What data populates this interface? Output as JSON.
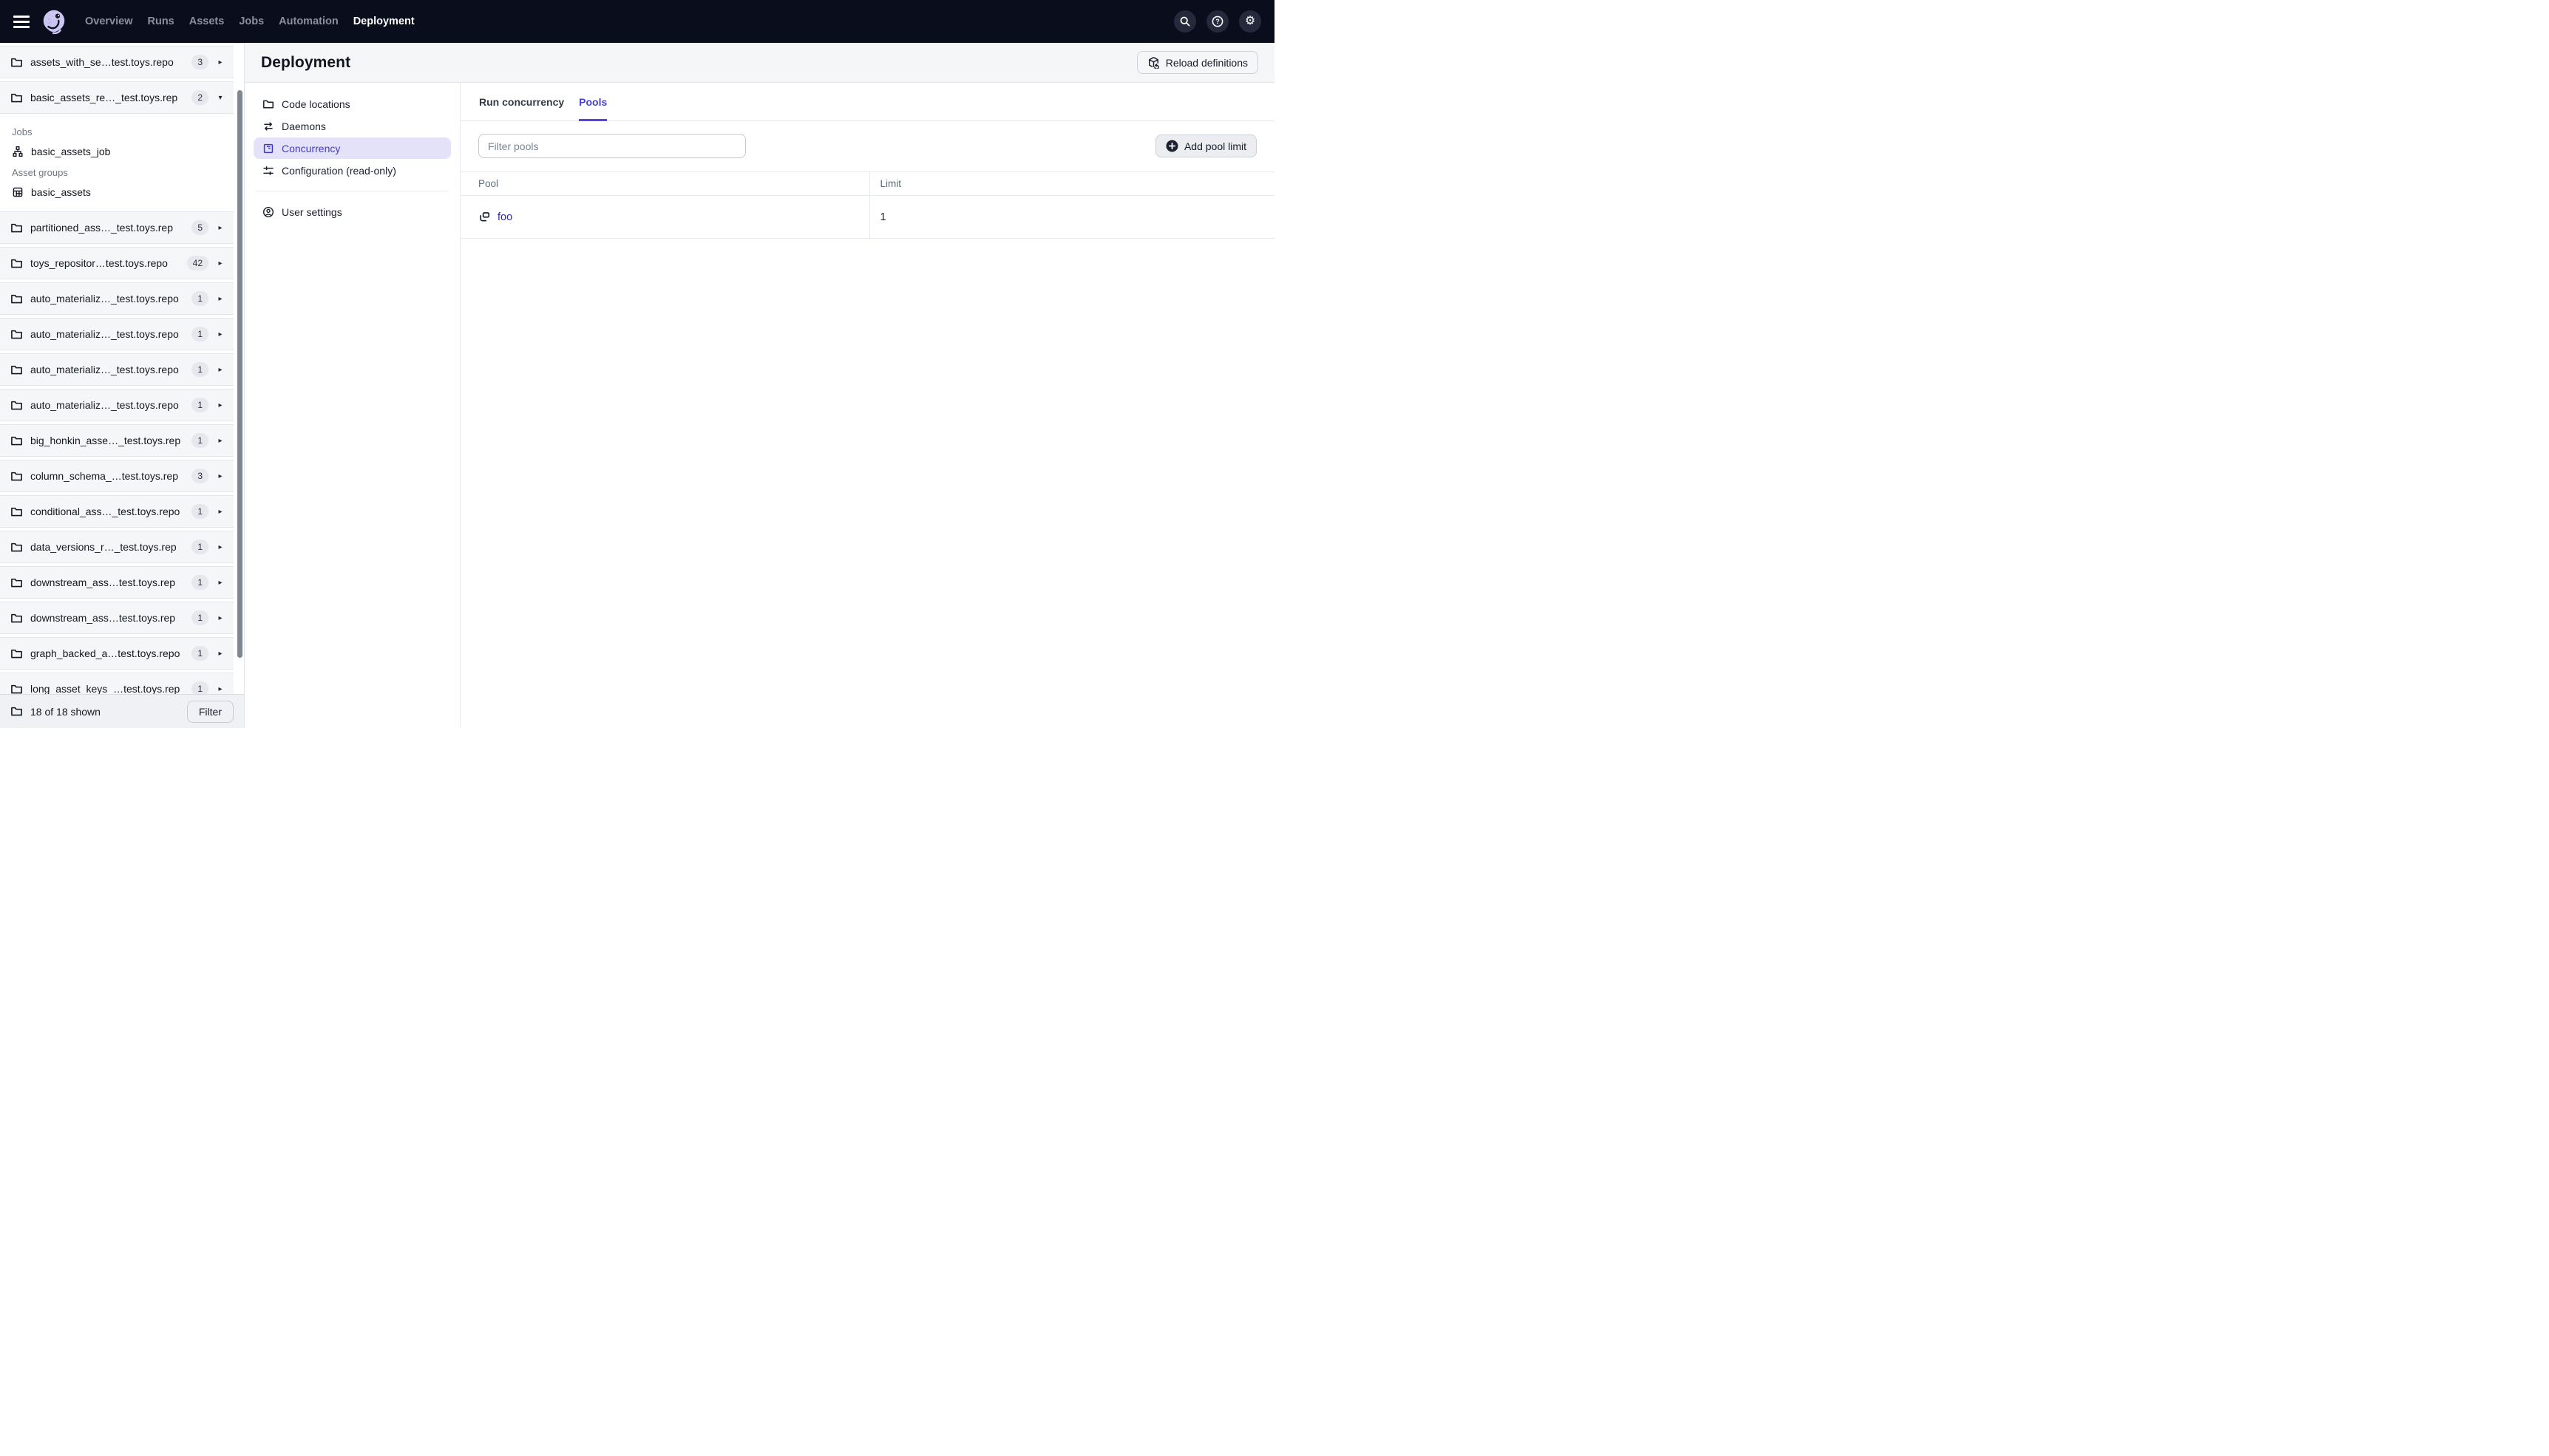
{
  "colors": {
    "topbar_bg": "#0A0E1C",
    "accent": "#4F46E5",
    "active_nav_text": "#4238C8",
    "active_nav_bg": "#E4E2F8",
    "link": "#2D28A6",
    "row_bg": "#F5F6F8",
    "border": "#E6E9EE"
  },
  "icons": {
    "chevron_right": "▸",
    "chevron_down": "▾",
    "gear": "⚙"
  },
  "topbar": {
    "nav": [
      {
        "label": "Overview"
      },
      {
        "label": "Runs"
      },
      {
        "label": "Assets"
      },
      {
        "label": "Jobs"
      },
      {
        "label": "Automation"
      },
      {
        "label": "Deployment",
        "active": true
      }
    ]
  },
  "sidebar": {
    "repos_top": [
      {
        "name": "assets_with_se…test.toys.repo",
        "count": "3"
      },
      {
        "name": "basic_assets_re…_test.toys.rep",
        "count": "2",
        "expanded": true
      }
    ],
    "expanded": {
      "jobs_heading": "Jobs",
      "jobs": [
        {
          "name": "basic_assets_job"
        }
      ],
      "groups_heading": "Asset groups",
      "groups": [
        {
          "name": "basic_assets"
        }
      ]
    },
    "repos_more": [
      {
        "name": "partitioned_ass…_test.toys.rep",
        "count": "5"
      },
      {
        "name": "toys_repositor…test.toys.repo",
        "count": "42"
      },
      {
        "name": "auto_materializ…_test.toys.repo",
        "count": "1"
      },
      {
        "name": "auto_materializ…_test.toys.repo",
        "count": "1"
      },
      {
        "name": "auto_materializ…_test.toys.repo",
        "count": "1"
      },
      {
        "name": "auto_materializ…_test.toys.repo",
        "count": "1"
      },
      {
        "name": "big_honkin_asse…_test.toys.rep",
        "count": "1"
      },
      {
        "name": "column_schema_…test.toys.rep",
        "count": "3"
      },
      {
        "name": "conditional_ass…_test.toys.repo",
        "count": "1"
      },
      {
        "name": "data_versions_r…_test.toys.rep",
        "count": "1"
      },
      {
        "name": "downstream_ass…test.toys.rep",
        "count": "1"
      },
      {
        "name": "downstream_ass…test.toys.rep",
        "count": "1"
      },
      {
        "name": "graph_backed_a…test.toys.repo",
        "count": "1"
      },
      {
        "name": "long_asset_keys_…test.toys.rep",
        "count": "1"
      }
    ],
    "footer": {
      "count_label": "18 of 18 shown",
      "filter_button": "Filter"
    }
  },
  "page": {
    "title": "Deployment",
    "reload_button": "Reload definitions"
  },
  "settings_nav": {
    "primary": [
      {
        "label": "Code locations"
      },
      {
        "label": "Daemons"
      },
      {
        "label": "Concurrency",
        "active": true
      },
      {
        "label": "Configuration (read-only)"
      }
    ],
    "secondary": [
      {
        "label": "User settings"
      }
    ]
  },
  "concurrency": {
    "tabs": [
      {
        "label": "Run concurrency"
      },
      {
        "label": "Pools",
        "active": true
      }
    ],
    "filter_placeholder": "Filter pools",
    "add_button": "Add pool limit",
    "table": {
      "columns": [
        "Pool",
        "Limit"
      ],
      "rows": [
        {
          "pool": "foo",
          "limit": "1"
        }
      ]
    }
  }
}
